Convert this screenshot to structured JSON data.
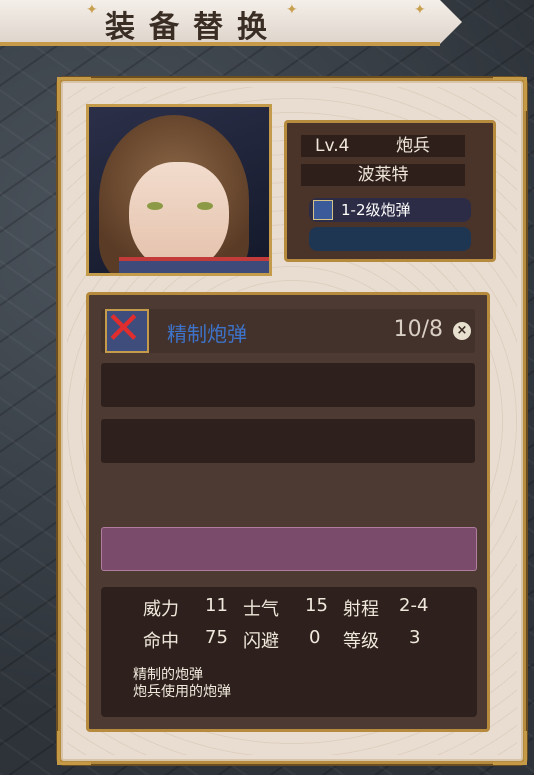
{
  "title": "装备替换",
  "character": {
    "level": "Lv.4",
    "class": "炮兵",
    "name": "波莱特",
    "weapon": "1-2级炮弹"
  },
  "equipment": {
    "selected": {
      "name": "精制炮弹",
      "count": "10/8",
      "close_symbol": "×"
    }
  },
  "stats": {
    "power_label": "威力",
    "power": "11",
    "morale_label": "士气",
    "morale": "15",
    "range_label": "射程",
    "range": "2-4",
    "hit_label": "命中",
    "hit": "75",
    "evade_label": "闪避",
    "evade": "0",
    "level_label": "等级",
    "level": "3"
  },
  "description": {
    "line1": "精制的炮弹",
    "line2": "炮兵使用的炮弹"
  }
}
